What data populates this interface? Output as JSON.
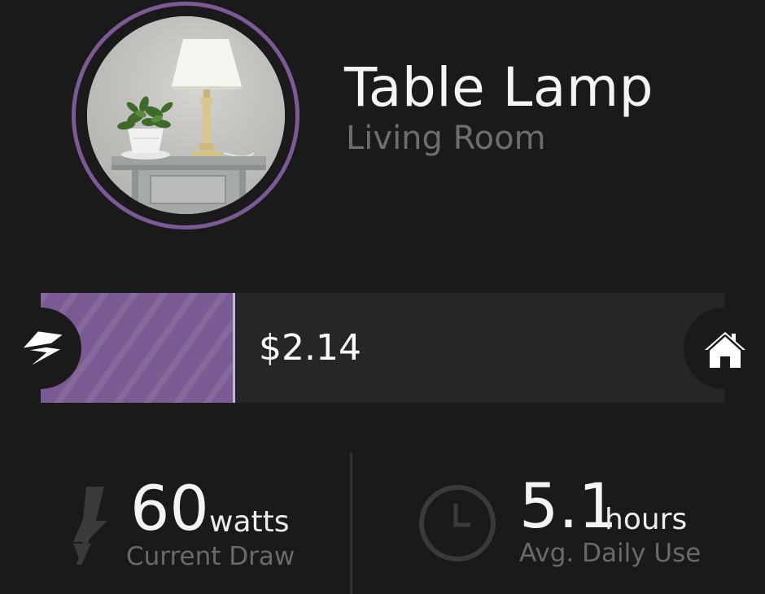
{
  "device": {
    "name": "Table Lamp",
    "room": "Living Room",
    "photo_alt": "table lamp on side table",
    "ring_color": "#7c5a96"
  },
  "cost_bar": {
    "value": "$2.14",
    "fill_fraction": 0.285,
    "fill_color": "#7a5a92",
    "left_icon": "bolt-icon",
    "right_icon": "home-icon"
  },
  "stats": {
    "current_draw": {
      "value": "60",
      "unit": "watts",
      "label": "Current Draw",
      "icon": "bolt-icon"
    },
    "avg_daily_use": {
      "value": "5.1",
      "unit": "hours",
      "label": "Avg. Daily Use",
      "icon": "clock-icon"
    }
  }
}
